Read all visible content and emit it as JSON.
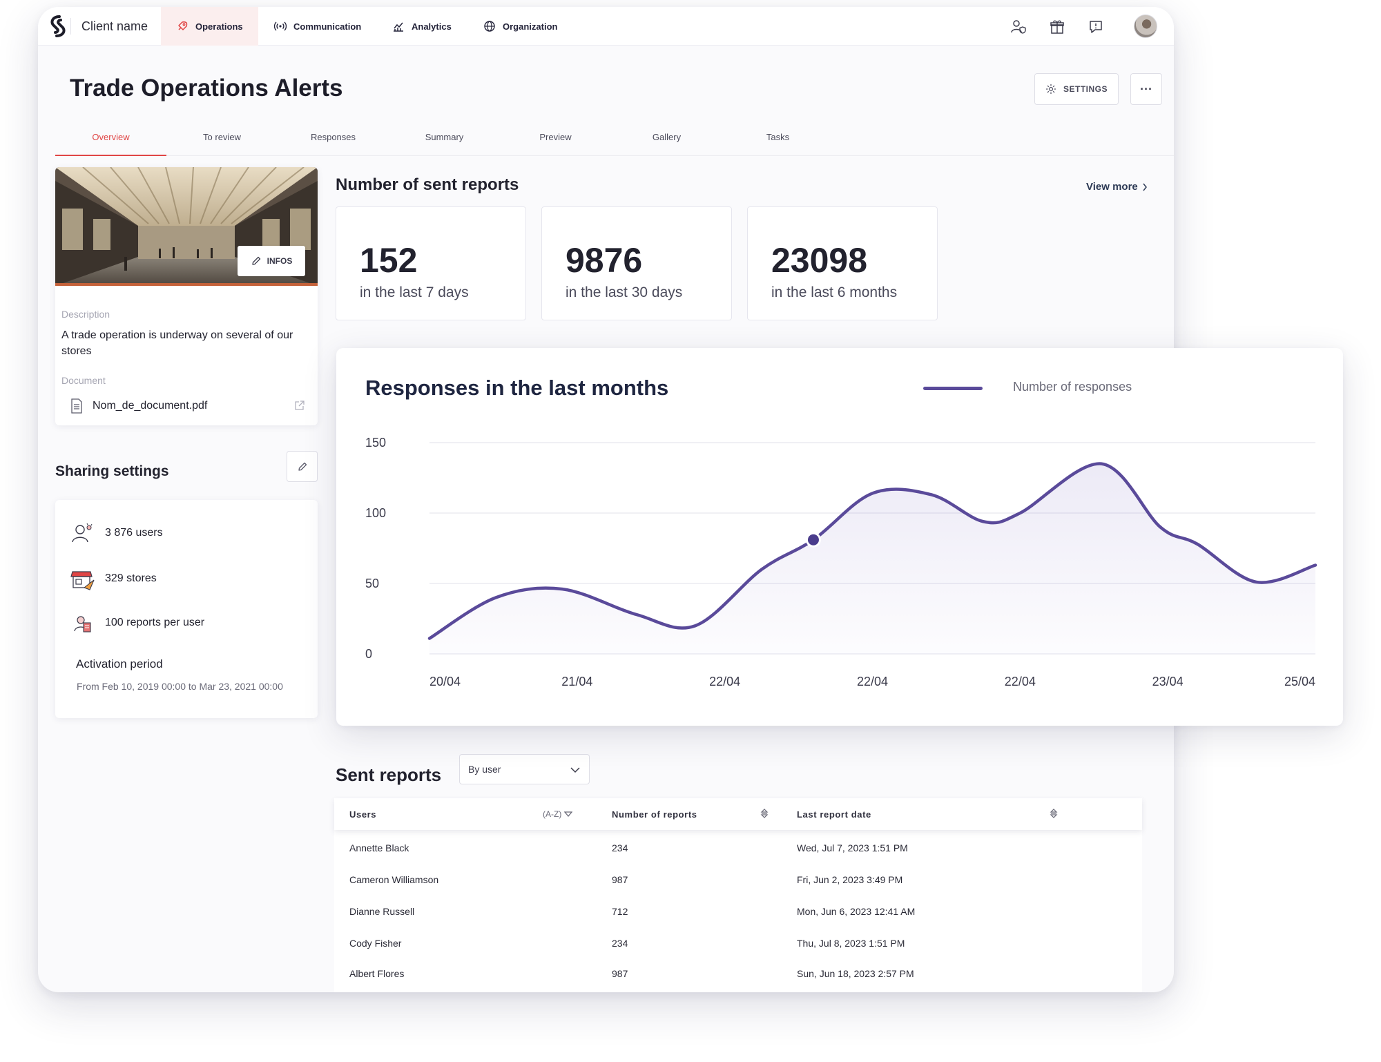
{
  "nav": {
    "client_name": "Client name",
    "items": [
      {
        "label": "Operations",
        "icon": "rocket-icon",
        "active": true
      },
      {
        "label": "Communication",
        "icon": "broadcast-icon",
        "active": false
      },
      {
        "label": "Analytics",
        "icon": "analytics-icon",
        "active": false
      },
      {
        "label": "Organization",
        "icon": "globe-icon",
        "active": false
      }
    ],
    "right_icons": [
      "user-shield-icon",
      "gift-icon",
      "chat-icon"
    ]
  },
  "page": {
    "title": "Trade Operations Alerts",
    "settings_label": "SETTINGS",
    "more_label": "···"
  },
  "tabs": [
    {
      "label": "Overview",
      "active": true
    },
    {
      "label": "To review",
      "active": false
    },
    {
      "label": "Responses",
      "active": false
    },
    {
      "label": "Summary",
      "active": false
    },
    {
      "label": "Preview",
      "active": false
    },
    {
      "label": "Gallery",
      "active": false
    },
    {
      "label": "Tasks",
      "active": false
    }
  ],
  "info": {
    "infos_label": "INFOS",
    "description_label": "Description",
    "description": "A trade operation is underway on several of our stores",
    "document_label": "Document",
    "document_name": "Nom_de_document.pdf"
  },
  "sharing": {
    "title": "Sharing settings",
    "rows": [
      {
        "label": "3 876 users",
        "icon": "users-icon"
      },
      {
        "label": "329 stores",
        "icon": "store-icon"
      },
      {
        "label": "100 reports per user",
        "icon": "reports-per-user-icon"
      }
    ],
    "activation_label": "Activation period",
    "activation_value": "From Feb 10, 2019 00:00 to Mar 23, 2021 00:00"
  },
  "stats": {
    "title": "Number of sent reports",
    "view_more": "View more",
    "cards": [
      {
        "value": "152",
        "label": "in the last 7 days"
      },
      {
        "value": "9876",
        "label": "in the last 30 days"
      },
      {
        "value": "23098",
        "label": "in the last 6 months"
      }
    ]
  },
  "chart_data": {
    "type": "area",
    "title": "Responses in the last months",
    "legend": [
      "Number of responses"
    ],
    "legend_placement": "top-right",
    "x_labels": [
      "20/04",
      "21/04",
      "22/04",
      "22/04",
      "22/04",
      "23/04",
      "25/04"
    ],
    "yticks": [
      0,
      50,
      100,
      150
    ],
    "ylim": [
      0,
      150
    ],
    "grid": true,
    "series": [
      {
        "name": "Number of responses",
        "color": "#5a4a9a",
        "points": [
          [
            0,
            11
          ],
          [
            0.45,
            40
          ],
          [
            0.9,
            46
          ],
          [
            1.4,
            28
          ],
          [
            1.8,
            20
          ],
          [
            2.25,
            60
          ],
          [
            2.6,
            81
          ],
          [
            3.0,
            114
          ],
          [
            3.4,
            113
          ],
          [
            3.75,
            94
          ],
          [
            4.0,
            100
          ],
          [
            4.55,
            135
          ],
          [
            4.95,
            90
          ],
          [
            5.2,
            78
          ],
          [
            5.6,
            51
          ],
          [
            6.0,
            63
          ]
        ],
        "highlight_point": [
          2.6,
          81
        ]
      }
    ]
  },
  "sent_reports": {
    "title": "Sent reports",
    "filter_value": "By user",
    "columns": {
      "users": "Users",
      "users_sort": "(A-Z)",
      "number": "Number of reports",
      "date": "Last report date"
    },
    "rows": [
      {
        "user": "Annette Black",
        "count": "234",
        "date": "Wed, Jul 7, 2023 1:51 PM"
      },
      {
        "user": "Cameron Williamson",
        "count": "987",
        "date": "Fri, Jun 2, 2023 3:49 PM"
      },
      {
        "user": "Dianne Russell",
        "count": "712",
        "date": "Mon, Jun 6, 2023 12:41 AM"
      },
      {
        "user": "Cody Fisher",
        "count": "234",
        "date": "Thu, Jul 8, 2023 1:51 PM"
      },
      {
        "user": "Albert Flores",
        "count": "987",
        "date": "Sun, Jun 18, 2023 2:57 PM"
      }
    ]
  },
  "colors": {
    "accent_red": "#e04545",
    "chart_purple": "#5a4a9a",
    "text_dark": "#1d1d29"
  }
}
